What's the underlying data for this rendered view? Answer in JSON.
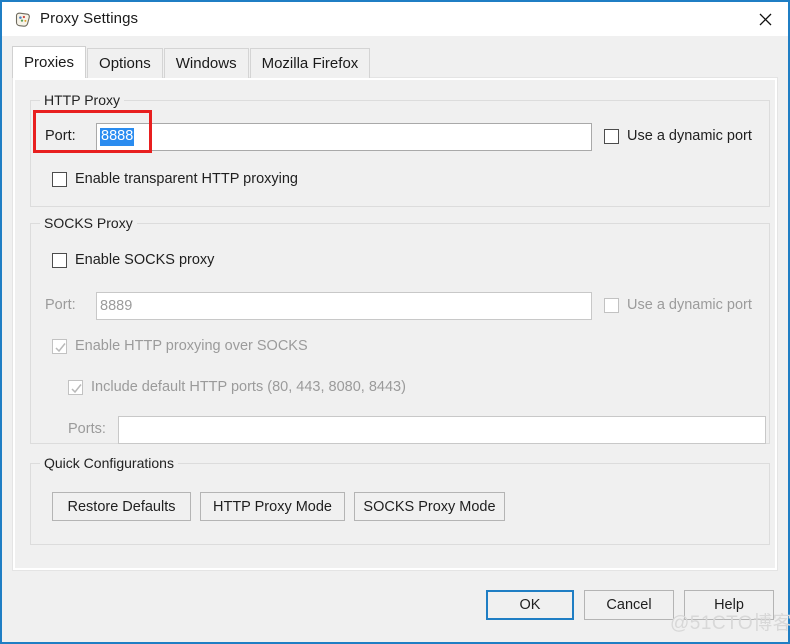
{
  "window": {
    "title": "Proxy Settings",
    "icon": "app-icon",
    "close_label": "✕",
    "accent_color": "#1f7ec4"
  },
  "tabs": [
    {
      "label": "Proxies",
      "active": true
    },
    {
      "label": "Options",
      "active": false
    },
    {
      "label": "Windows",
      "active": false
    },
    {
      "label": "Mozilla Firefox",
      "active": false
    }
  ],
  "http_proxy": {
    "group_title": "HTTP Proxy",
    "port_label": "Port:",
    "port_value": "8888",
    "port_selected": true,
    "dynamic_port_label": "Use a dynamic port",
    "dynamic_port_checked": false,
    "transparent_label": "Enable transparent HTTP proxying",
    "transparent_checked": false
  },
  "socks_proxy": {
    "group_title": "SOCKS Proxy",
    "enable_label": "Enable SOCKS proxy",
    "enable_checked": false,
    "port_label": "Port:",
    "port_value": "8889",
    "port_disabled": true,
    "dynamic_port_label": "Use a dynamic port",
    "dynamic_port_checked": false,
    "dynamic_port_disabled": true,
    "http_over_socks_label": "Enable HTTP proxying over SOCKS",
    "http_over_socks_checked": true,
    "http_over_socks_disabled": true,
    "include_default_label": "Include default HTTP ports (80, 443, 8080, 8443)",
    "include_default_checked": true,
    "include_default_disabled": true,
    "ports_label": "Ports:",
    "ports_value": "",
    "ports_disabled": true
  },
  "quick_configurations": {
    "group_title": "Quick Configurations",
    "buttons": [
      {
        "label": "Restore Defaults"
      },
      {
        "label": "HTTP Proxy Mode"
      },
      {
        "label": "SOCKS Proxy Mode"
      }
    ]
  },
  "dialog_buttons": [
    {
      "label": "OK",
      "default": true
    },
    {
      "label": "Cancel",
      "default": false
    },
    {
      "label": "Help",
      "default": false
    }
  ],
  "annotation": {
    "highlight_color": "#e81f1f",
    "target": "http-port-field"
  },
  "watermark": {
    "text": "@51CTO博客"
  }
}
